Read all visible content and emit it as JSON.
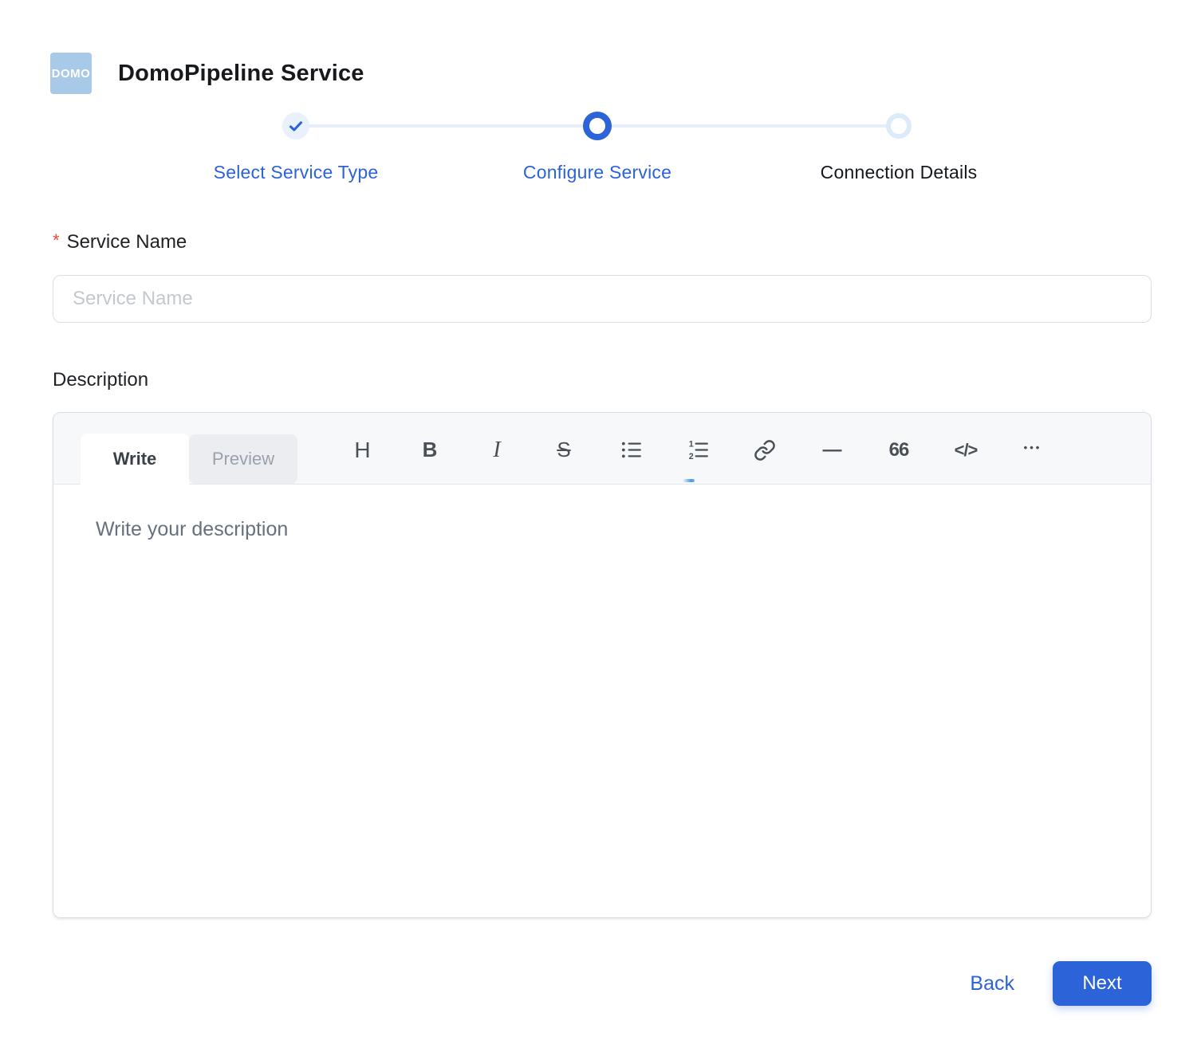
{
  "app": {
    "logo_text": "DOMO",
    "title": "DomoPipeline Service"
  },
  "stepper": {
    "steps": [
      {
        "label": "Select Service Type",
        "state": "completed"
      },
      {
        "label": "Configure Service",
        "state": "active"
      },
      {
        "label": "Connection Details",
        "state": "upcoming"
      }
    ]
  },
  "form": {
    "service_name": {
      "required_marker": "*",
      "label": "Service Name",
      "placeholder": "Service Name",
      "value": ""
    },
    "description": {
      "label": "Description",
      "placeholder": "Write your description",
      "value": "",
      "tabs": [
        {
          "label": "Write",
          "active": true
        },
        {
          "label": "Preview",
          "active": false
        }
      ],
      "toolbar": {
        "items": [
          {
            "name": "heading",
            "glyph": "H"
          },
          {
            "name": "bold",
            "glyph": "B"
          },
          {
            "name": "italic",
            "glyph": "I"
          },
          {
            "name": "strikethrough",
            "glyph": "S"
          },
          {
            "name": "unordered-list",
            "glyph": ""
          },
          {
            "name": "ordered-list",
            "glyph": ""
          },
          {
            "name": "link",
            "glyph": ""
          },
          {
            "name": "horizontal-rule",
            "glyph": "—"
          },
          {
            "name": "quote",
            "glyph": "66"
          },
          {
            "name": "code",
            "glyph": "</>"
          },
          {
            "name": "more",
            "glyph": "•••"
          }
        ]
      }
    }
  },
  "footer": {
    "back_label": "Back",
    "next_label": "Next"
  },
  "colors": {
    "accent": "#2d63d8",
    "logo_bg": "#a9c9e9",
    "completed_step_bg": "#e8f1fc",
    "upcoming_ring": "#ddeafa",
    "connector": "#e6edf7",
    "required_marker": "#ef4444"
  }
}
